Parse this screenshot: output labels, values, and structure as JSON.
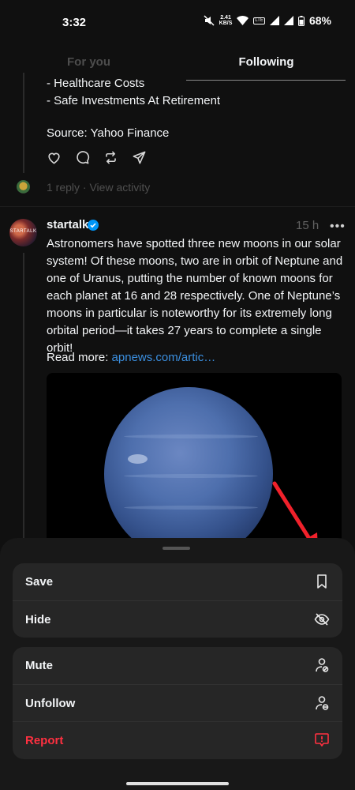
{
  "status_bar": {
    "time": "3:32",
    "net_speed_value": "2.41",
    "net_speed_unit": "KB/S",
    "network_type": "LTE",
    "battery": "68%"
  },
  "tabs": [
    {
      "label": "For you",
      "active": false
    },
    {
      "label": "Following",
      "active": true
    }
  ],
  "previous_post": {
    "lines": [
      "- Healthcare Costs",
      "- Safe Investments At Retirement"
    ],
    "source": "Source: Yahoo Finance",
    "activity": "1 reply · View activity"
  },
  "post": {
    "avatar_text": "STARTALK",
    "username": "startalk",
    "time": "15 h",
    "more": "•••",
    "text": "Astronomers have spotted three new moons in our solar system! Of these moons, two are in orbit of Neptune and one of Uranus, putting the number of known moons for each planet at 16 and 28 respectively. One of Neptune’s moons in particular is noteworthy for its extremely long orbital period—it takes 27 years to complete a single orbit!",
    "read_more_prefix": "Read more: ",
    "read_more_link": "apnews.com/artic…"
  },
  "sheet": {
    "group1": [
      {
        "label": "Save",
        "icon": "bookmark-icon"
      },
      {
        "label": "Hide",
        "icon": "eye-off-icon"
      }
    ],
    "group2": [
      {
        "label": "Mute",
        "icon": "mute-user-icon"
      },
      {
        "label": "Unfollow",
        "icon": "unfollow-user-icon"
      },
      {
        "label": "Report",
        "icon": "report-icon"
      }
    ]
  },
  "colors": {
    "background": "#101010",
    "link": "#3b8fe0",
    "danger": "#ff3040",
    "arrow": "#f0212b"
  }
}
